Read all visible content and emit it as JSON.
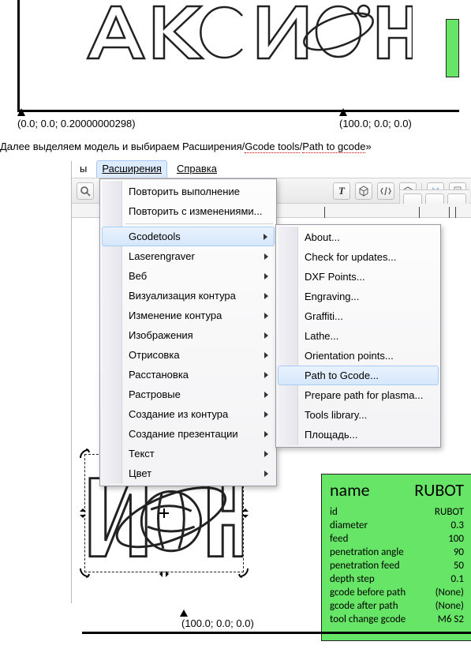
{
  "top_canvas": {
    "coord_left": "(0.0; 0.0; 0.20000000298)",
    "coord_right": "(100.0; 0.0; 0.0)"
  },
  "instruction": {
    "prefix": "Далее выделяем модель и выбираем Расширения/",
    "dotted1": "Gcode tools",
    "slash": "/",
    "dotted2": "Path to gcode",
    "suffix": "»"
  },
  "menubar": {
    "left_fragment": "ы",
    "extensions": "Расширения",
    "help": "Справка"
  },
  "toolbar": {
    "text_tool": "T"
  },
  "extensions_menu": {
    "repeat": "Повторить выполнение",
    "repeat_with_changes": "Повторить с изменениями...",
    "items": [
      "Gcodetools",
      "Laserengraver",
      "Веб",
      "Визуализация контура",
      "Изменение контура",
      "Изображения",
      "Отрисовка",
      "Расстановка",
      "Растровые",
      "Создание из контура",
      "Создание презентации",
      "Текст",
      "Цвет"
    ]
  },
  "gcodetools_submenu": {
    "items": [
      "About...",
      "Check for updates...",
      "DXF Points...",
      "Engraving...",
      "Graffiti...",
      "Lathe...",
      "Orientation points...",
      "Path to Gcode...",
      "Prepare path for plasma...",
      "Tools library...",
      "Площадь..."
    ]
  },
  "green_tool": {
    "header_key": "name",
    "header_val": "RUBOT",
    "rows": [
      {
        "k": "id",
        "v": "RUBOT"
      },
      {
        "k": "diameter",
        "v": "0.3"
      },
      {
        "k": "feed",
        "v": "100"
      },
      {
        "k": "penetration angle",
        "v": "90"
      },
      {
        "k": "penetration feed",
        "v": "50"
      },
      {
        "k": "depth step",
        "v": "0.1"
      },
      {
        "k": "gcode before path",
        "v": "(None)"
      },
      {
        "k": "gcode after path",
        "v": "(None)"
      },
      {
        "k": "tool change gcode",
        "v": "M6 S2"
      }
    ]
  },
  "bottom": {
    "coord": "(100.0; 0.0; 0.0)"
  }
}
